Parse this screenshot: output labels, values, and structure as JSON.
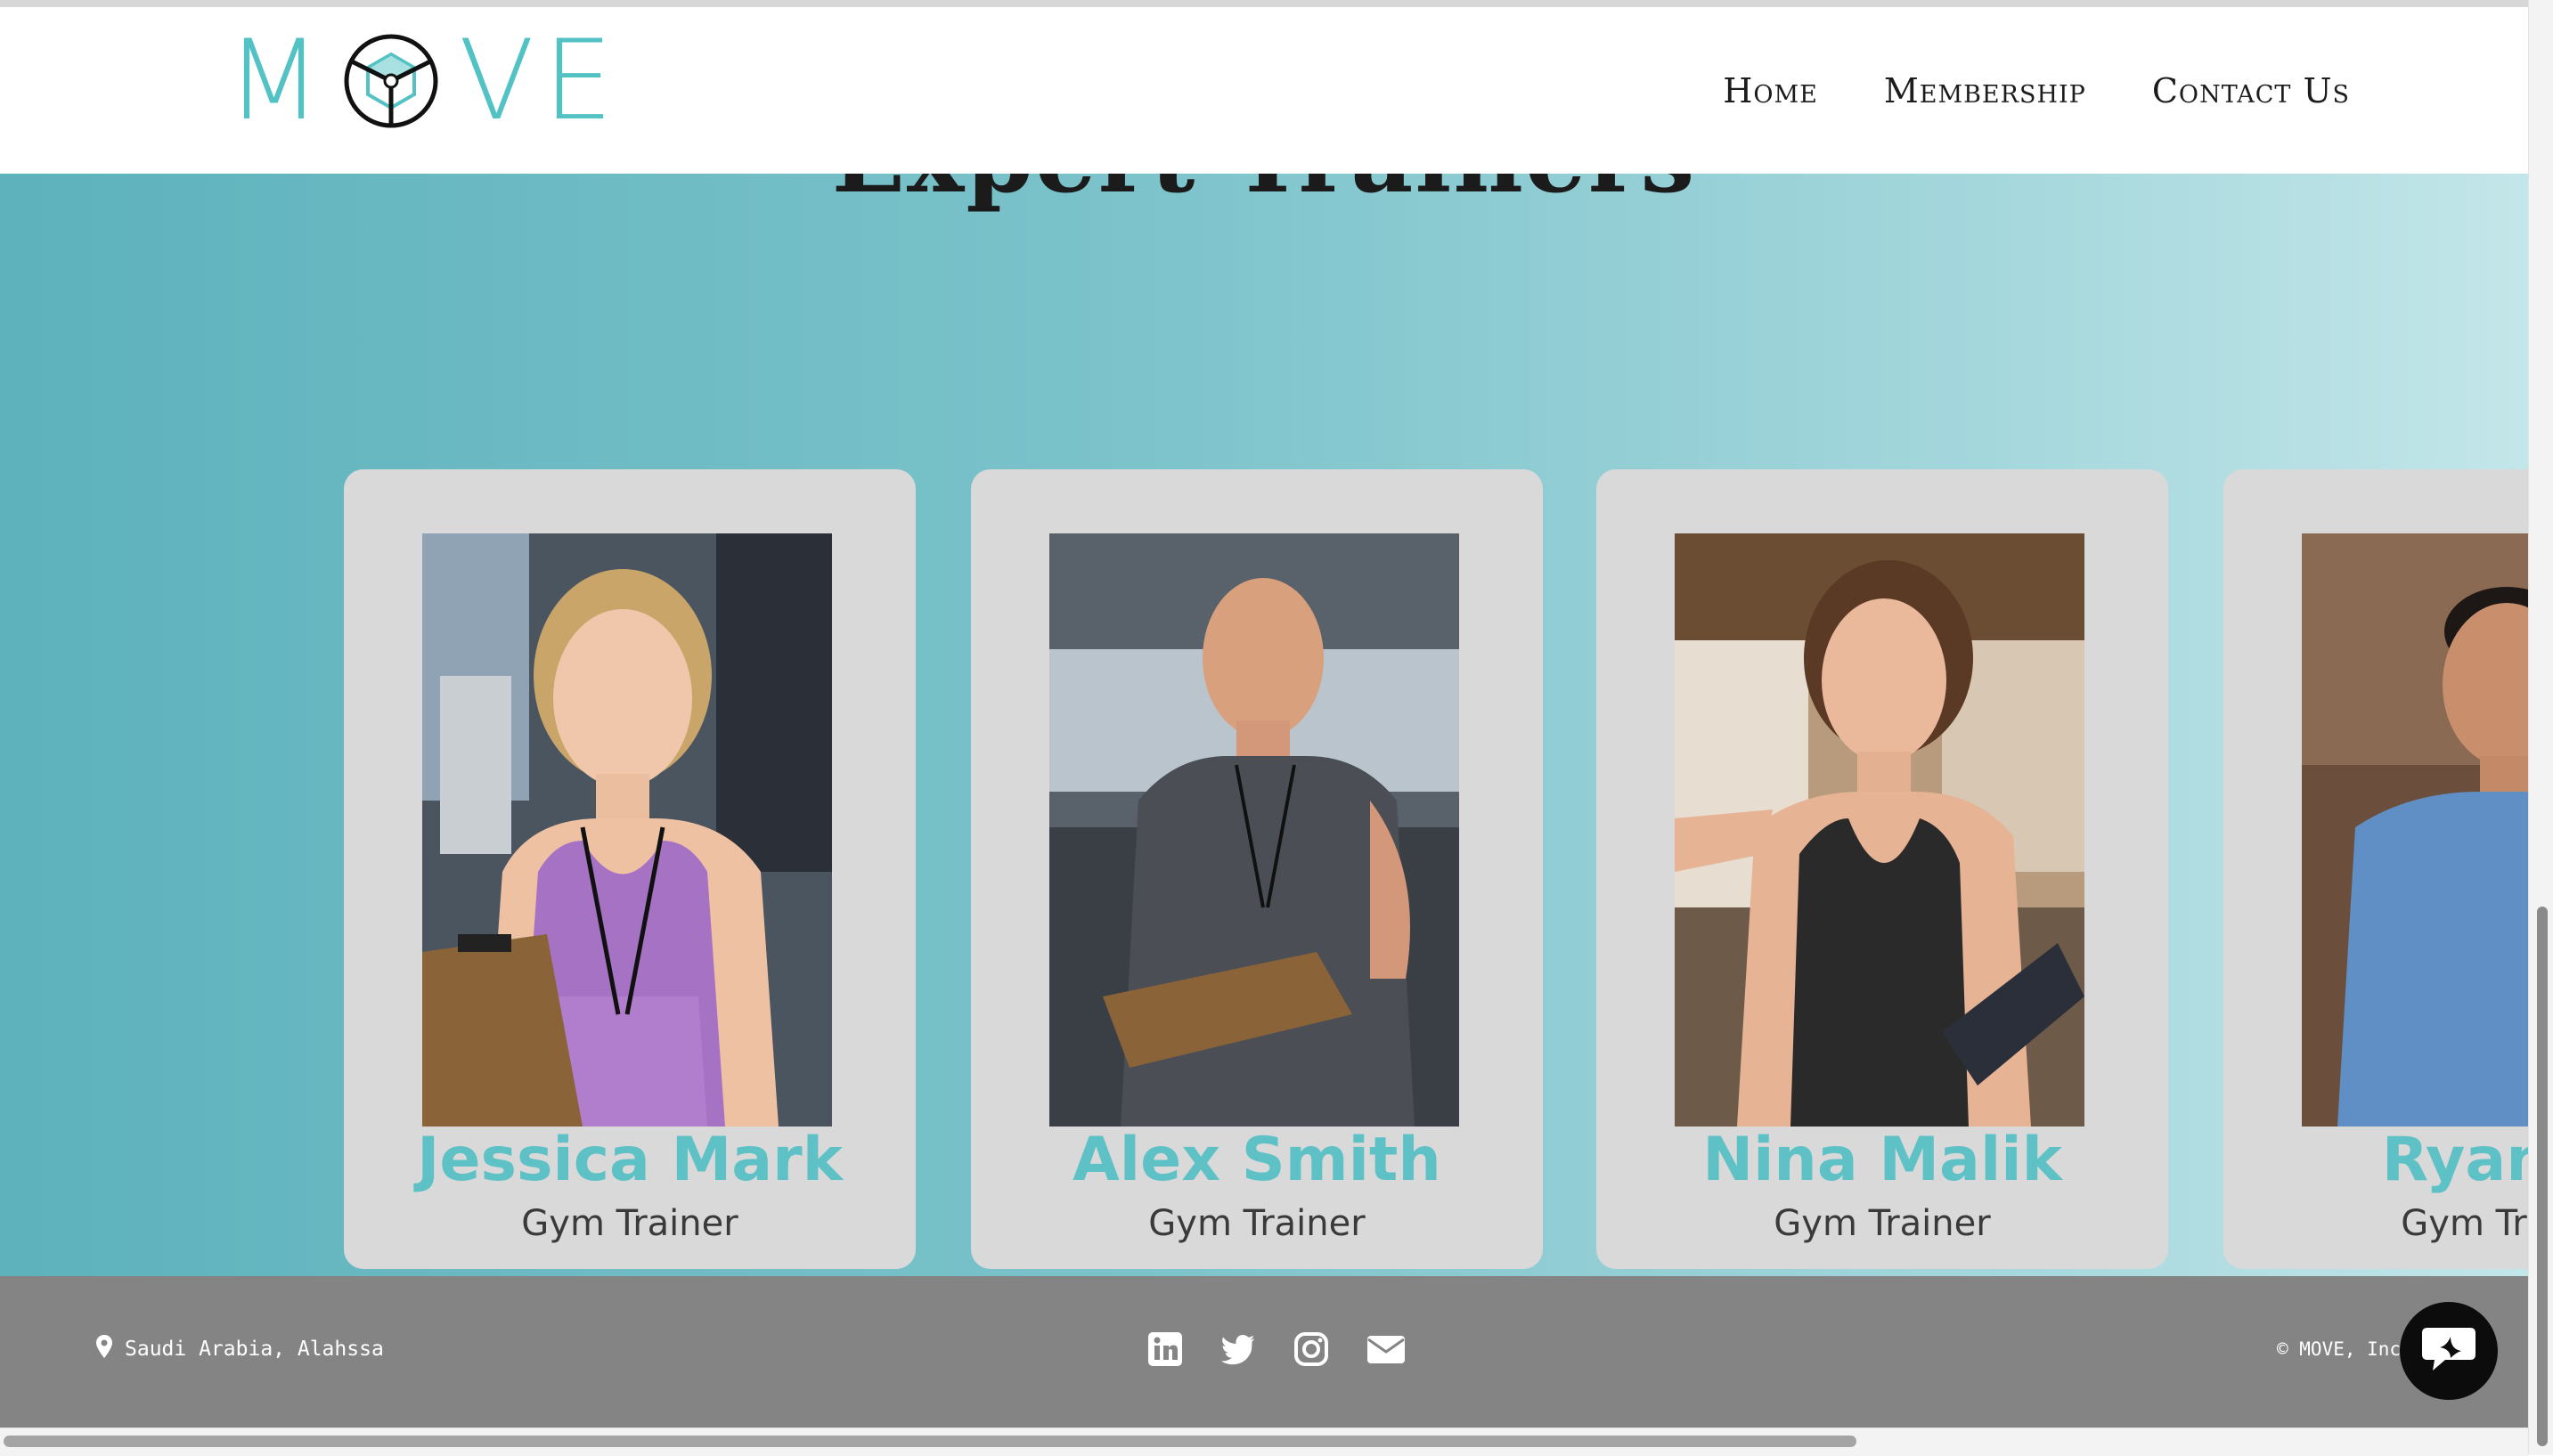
{
  "brand": {
    "logo_left": "M",
    "logo_right": "VE"
  },
  "nav": [
    {
      "label": "Home"
    },
    {
      "label": "Membership"
    },
    {
      "label": "Contact Us"
    }
  ],
  "section": {
    "title": "Expert Trainers"
  },
  "trainers": [
    {
      "name": "Jessica Mark",
      "role": "Gym Trainer"
    },
    {
      "name": "Alex Smith",
      "role": "Gym Trainer"
    },
    {
      "name": "Nina Malik",
      "role": "Gym Trainer"
    },
    {
      "name": "Ryan W",
      "role": "Gym Trainer"
    }
  ],
  "footer": {
    "location": "Saudi Arabia, Alahssa",
    "copyright": "© MOVE, Inc",
    "social_icons": [
      "linkedin-icon",
      "twitter-icon",
      "instagram-icon",
      "envelope-icon"
    ]
  },
  "colors": {
    "accent": "#52c2c4",
    "footer": "#848484",
    "card": "#d9d9d9"
  }
}
